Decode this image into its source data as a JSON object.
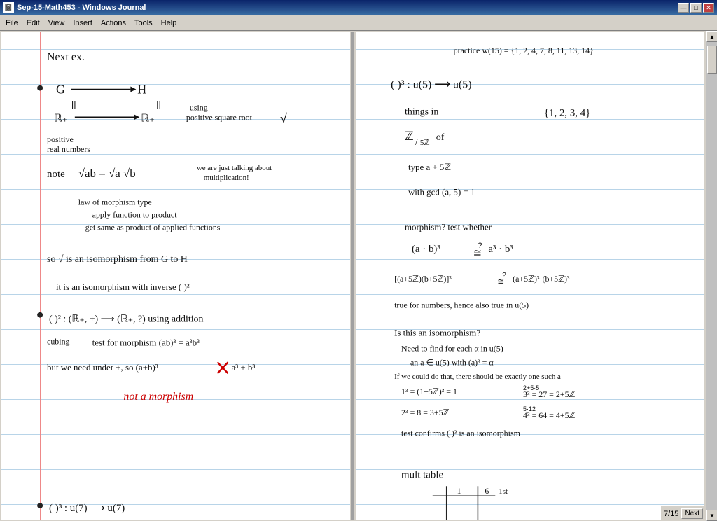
{
  "window": {
    "title": "Sep-15-Math453 - Windows Journal",
    "icon": "📓"
  },
  "titlebar": {
    "minimize": "—",
    "maximize": "□",
    "close": "✕"
  },
  "menu": {
    "items": [
      "File",
      "Edit",
      "View",
      "Insert",
      "Actions",
      "Tools",
      "Help"
    ]
  },
  "pages": {
    "left": {
      "content": "left page handwritten math notes"
    },
    "right": {
      "content": "right page handwritten math notes"
    }
  },
  "status": {
    "page": "7",
    "total": "15",
    "next_label": "Next"
  }
}
